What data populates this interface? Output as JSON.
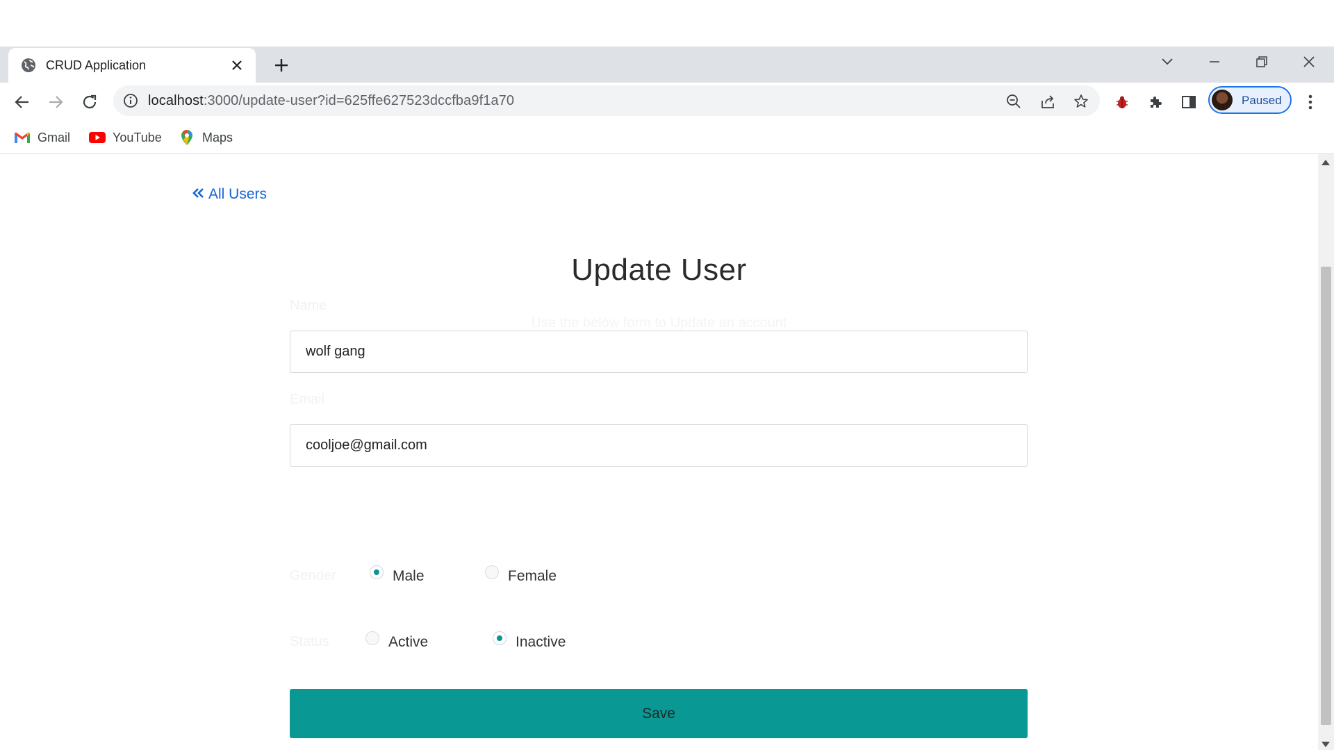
{
  "browser": {
    "tab": {
      "title": "CRUD Application",
      "favicon": "globe-icon"
    },
    "url": {
      "host": "localhost",
      "rest": ":3000/update-user?id=625ffe627523dccfba9f1a70"
    },
    "profile": {
      "label": "Paused"
    },
    "bookmarks": [
      {
        "label": "Gmail",
        "icon": "gmail-icon"
      },
      {
        "label": "YouTube",
        "icon": "youtube-icon"
      },
      {
        "label": "Maps",
        "icon": "maps-icon"
      }
    ]
  },
  "page": {
    "back_link": {
      "label": "All Users",
      "icon": "double-chevron-left-icon"
    },
    "title": "Update User",
    "subtitle": "Use the below form to Update an account",
    "form": {
      "name": {
        "label": "Name",
        "value": "wolf gang"
      },
      "email": {
        "label": "Email",
        "value": "cooljoe@gmail.com"
      },
      "gender": {
        "label": "Gender",
        "options": [
          "Male",
          "Female"
        ],
        "selected": "Male"
      },
      "status": {
        "label": "Status",
        "options": [
          "Active",
          "Inactive"
        ],
        "selected": "Inactive"
      },
      "save_label": "Save"
    }
  },
  "colors": {
    "accent": "#099893",
    "link": "#1565d8",
    "profile_border": "#1a73e8"
  }
}
